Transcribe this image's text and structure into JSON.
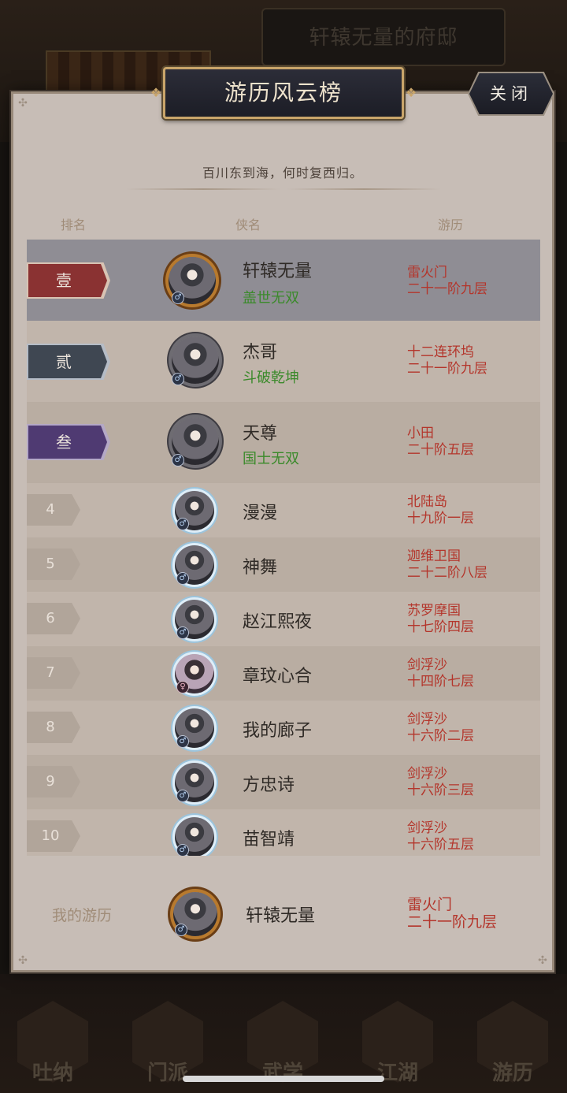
{
  "background": {
    "mansion_title": "轩辕无量的府邸",
    "nav": [
      {
        "label": "吐纳"
      },
      {
        "label": "门派"
      },
      {
        "label": "武学"
      },
      {
        "label": "江湖"
      },
      {
        "label": "游历"
      }
    ]
  },
  "panel": {
    "title": "游历风云榜",
    "close_label": "关闭",
    "subtitle": "百川东到海，何时复西归。",
    "columns": {
      "rank": "排名",
      "hero": "侠名",
      "travel": "游历"
    }
  },
  "rows": [
    {
      "rank": "壹",
      "name": "轩辕无量",
      "title": "盖世无双",
      "place": "雷火门",
      "stage": "二十一阶九层",
      "gender": "♂"
    },
    {
      "rank": "贰",
      "name": "杰哥",
      "title": "斗破乾坤",
      "place": "十二连环坞",
      "stage": "二十一阶九层",
      "gender": "♂"
    },
    {
      "rank": "叁",
      "name": "天尊",
      "title": "国士无双",
      "place": "小田",
      "stage": "二十阶五层",
      "gender": "♂"
    },
    {
      "rank": "4",
      "name": "漫漫",
      "place": "北陆岛",
      "stage": "十九阶一层",
      "gender": "♂"
    },
    {
      "rank": "5",
      "name": "神舞",
      "place": "迦维卫国",
      "stage": "二十二阶八层",
      "gender": "♂"
    },
    {
      "rank": "6",
      "name": "赵江熙夜",
      "place": "苏罗摩国",
      "stage": "十七阶四层",
      "gender": "♂"
    },
    {
      "rank": "7",
      "name": "章玟心合",
      "place": "剑浮沙",
      "stage": "十四阶七层",
      "gender": "♀"
    },
    {
      "rank": "8",
      "name": "我的廊子",
      "place": "剑浮沙",
      "stage": "十六阶二层",
      "gender": "♂"
    },
    {
      "rank": "9",
      "name": "方忠诗",
      "place": "剑浮沙",
      "stage": "十六阶三层",
      "gender": "♂"
    },
    {
      "rank": "10",
      "name": "苗智靖",
      "place": "剑浮沙",
      "stage": "十六阶五层",
      "gender": "♂"
    }
  ],
  "mine": {
    "label": "我的游历",
    "name": "轩辕无量",
    "place": "雷火门",
    "stage": "二十一阶九层",
    "gender": "♂"
  },
  "colors": {
    "rank1": "#8a3232",
    "rank2": "#3f4752",
    "rank3": "#4f3a72",
    "title_green": "#3b8a2b",
    "location_red": "#b4352b"
  }
}
